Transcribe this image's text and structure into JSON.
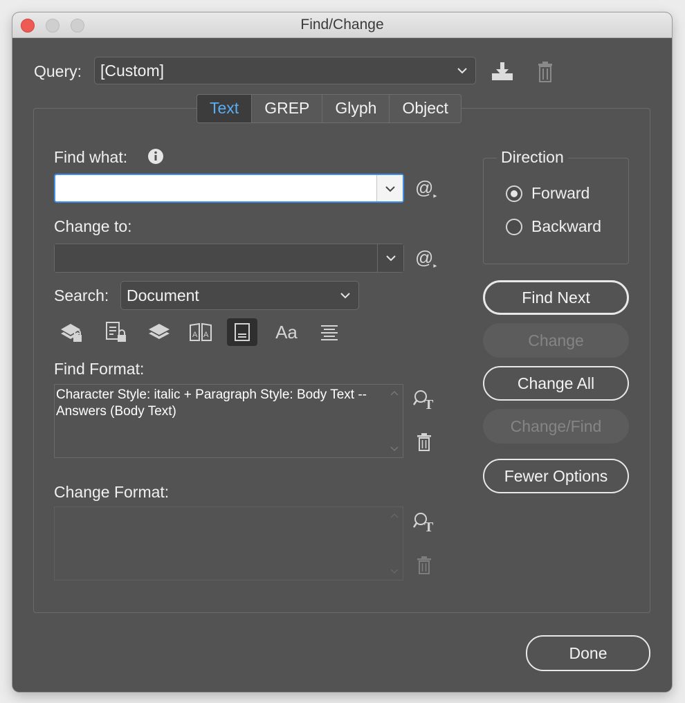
{
  "window": {
    "title": "Find/Change"
  },
  "query": {
    "label": "Query:",
    "value": "[Custom]"
  },
  "tabs": [
    {
      "label": "Text",
      "active": true
    },
    {
      "label": "GREP",
      "active": false
    },
    {
      "label": "Glyph",
      "active": false
    },
    {
      "label": "Object",
      "active": false
    }
  ],
  "find": {
    "label": "Find what:",
    "value": ""
  },
  "change": {
    "label": "Change to:",
    "value": ""
  },
  "search": {
    "label": "Search:",
    "value": "Document"
  },
  "options_icons": [
    "include-locked-layers-icon",
    "include-locked-stories-icon",
    "include-hidden-layers-icon",
    "include-master-pages-icon",
    "include-footnotes-icon",
    "case-sensitive-icon",
    "whole-word-icon"
  ],
  "case_sensitive_label": "Aa",
  "find_format": {
    "label": "Find Format:",
    "value": "Character Style: italic + Paragraph Style: Body Text -- Answers (Body Text)"
  },
  "change_format": {
    "label": "Change Format:",
    "value": ""
  },
  "direction": {
    "label": "Direction",
    "options": [
      {
        "label": "Forward",
        "selected": true
      },
      {
        "label": "Backward",
        "selected": false
      }
    ]
  },
  "buttons": {
    "find_next": "Find Next",
    "change": "Change",
    "change_all": "Change All",
    "change_find": "Change/Find",
    "fewer_options": "Fewer Options",
    "done": "Done"
  },
  "colors": {
    "accent": "#3e8fe6",
    "active_tab_text": "#5aaef5",
    "dialog_bg": "#535353"
  }
}
